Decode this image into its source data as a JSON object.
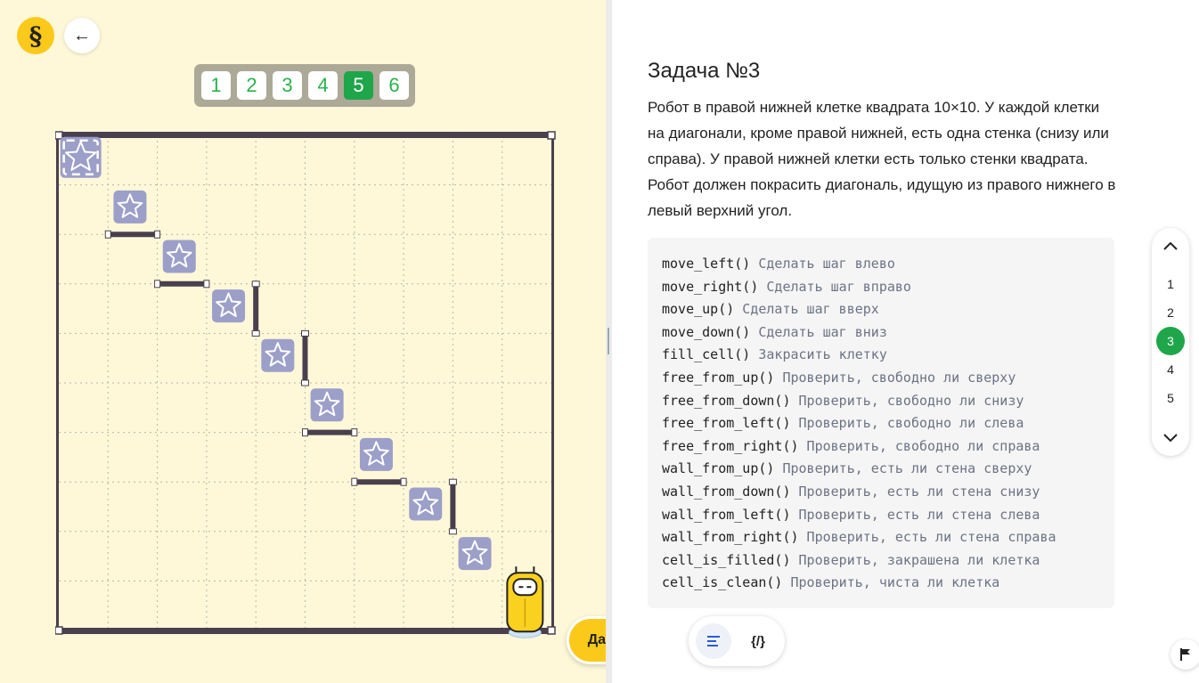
{
  "header": {
    "logo_glyph": "§",
    "back_glyph": "←"
  },
  "levels": [
    {
      "label": "1",
      "active": false
    },
    {
      "label": "2",
      "active": false
    },
    {
      "label": "3",
      "active": false
    },
    {
      "label": "4",
      "active": false
    },
    {
      "label": "5",
      "active": true
    },
    {
      "label": "6",
      "active": false
    }
  ],
  "board": {
    "rows": 10,
    "cols": 10,
    "robot_cell": {
      "row": 9,
      "col": 9
    },
    "target_cells": [
      {
        "row": 0,
        "col": 0,
        "dashed": true
      },
      {
        "row": 1,
        "col": 1
      },
      {
        "row": 2,
        "col": 2
      },
      {
        "row": 3,
        "col": 3
      },
      {
        "row": 4,
        "col": 4
      },
      {
        "row": 5,
        "col": 5
      },
      {
        "row": 6,
        "col": 6
      },
      {
        "row": 7,
        "col": 7
      },
      {
        "row": 8,
        "col": 8
      }
    ],
    "walls": [
      {
        "row": 1,
        "col": 1,
        "side": "bottom"
      },
      {
        "row": 2,
        "col": 2,
        "side": "bottom"
      },
      {
        "row": 3,
        "col": 3,
        "side": "right"
      },
      {
        "row": 4,
        "col": 4,
        "side": "right"
      },
      {
        "row": 5,
        "col": 5,
        "side": "bottom"
      },
      {
        "row": 6,
        "col": 6,
        "side": "bottom"
      },
      {
        "row": 7,
        "col": 7,
        "side": "right"
      }
    ],
    "colors": {
      "background": "#fef8d9",
      "wall": "#4a3f4d",
      "target": "#9c9fc8",
      "robot": "#fbd11f"
    }
  },
  "next_button": {
    "label": "Дальше"
  },
  "task": {
    "title": "Задача №3",
    "description": "Робот в правой нижней клетке квадрата 10×10. У каждой клетки на диагонали, кроме правой нижней, есть одна стенка (снизу или справа). У правой нижней клетки есть только стенки квадрата. Робот должен покрасить диагональ, идущую из правого нижнего в левый верхний угол."
  },
  "commands": [
    {
      "fn": "move_left()",
      "desc": "Сделать шаг влево"
    },
    {
      "fn": "move_right()",
      "desc": "Сделать шаг вправо"
    },
    {
      "fn": "move_up()",
      "desc": "Сделать шаг вверх"
    },
    {
      "fn": "move_down()",
      "desc": "Сделать шаг вниз"
    },
    {
      "fn": "fill_cell()",
      "desc": "Закрасить клетку"
    },
    {
      "fn": "free_from_up()",
      "desc": "Проверить, свободно ли сверху"
    },
    {
      "fn": "free_from_down()",
      "desc": "Проверить, свободно ли снизу"
    },
    {
      "fn": "free_from_left()",
      "desc": "Проверить, свободно ли слева"
    },
    {
      "fn": "free_from_right()",
      "desc": "Проверить, свободно ли справа"
    },
    {
      "fn": "wall_from_up()",
      "desc": "Проверить, есть ли стена сверху"
    },
    {
      "fn": "wall_from_down()",
      "desc": "Проверить, есть ли стена снизу"
    },
    {
      "fn": "wall_from_left()",
      "desc": "Проверить, есть ли стена слева"
    },
    {
      "fn": "wall_from_right()",
      "desc": "Проверить, есть ли стена справа"
    },
    {
      "fn": "cell_is_filled()",
      "desc": "Проверить, закрашена ли клетка"
    },
    {
      "fn": "cell_is_clean()",
      "desc": "Проверить, чиста ли клетка"
    }
  ],
  "task_nav": {
    "items": [
      "1",
      "2",
      "3",
      "4",
      "5"
    ],
    "active": "3"
  },
  "mode_toggle": {
    "text_mode": "text-lines-icon",
    "code_mode_glyph": "{/}"
  },
  "accent_color": "#1fa64a"
}
